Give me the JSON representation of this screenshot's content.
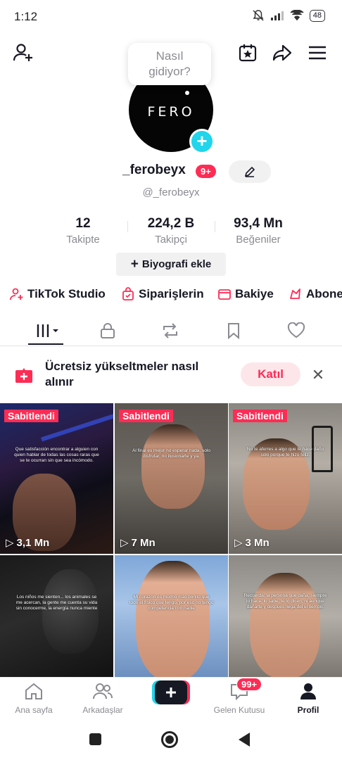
{
  "status": {
    "time": "1:12",
    "battery": "48"
  },
  "bubble": {
    "line1": "Nasıl",
    "line2": "gidiyor?"
  },
  "avatar": {
    "text": "FERO"
  },
  "profile": {
    "username": "_ferobeyx",
    "badge": "9+",
    "handle": "@_ferobeyx"
  },
  "stats": [
    {
      "value": "12",
      "label": "Takipte"
    },
    {
      "value": "224,2 B",
      "label": "Takipçi"
    },
    {
      "value": "93,4 Mn",
      "label": "Beğeniler"
    }
  ],
  "bio_button": "Biyografi ekle",
  "shortcuts": [
    {
      "label": "TikTok Studio",
      "icon": "person-plus-icon"
    },
    {
      "label": "Siparişlerin",
      "icon": "shopping-bag-icon"
    },
    {
      "label": "Bakiye",
      "icon": "wallet-icon"
    },
    {
      "label": "Abone",
      "icon": "subscription-icon"
    }
  ],
  "tabs": [
    {
      "name": "videos",
      "icon": "grid-bars-icon"
    },
    {
      "name": "private",
      "icon": "lock-icon"
    },
    {
      "name": "reposts",
      "icon": "repost-icon"
    },
    {
      "name": "favorites",
      "icon": "bookmark-icon"
    },
    {
      "name": "liked",
      "icon": "heart-icon"
    }
  ],
  "promo": {
    "text": "Ücretsiz yükseltmeler nasıl alınır",
    "join": "Katıl"
  },
  "videos": [
    {
      "pinned": "Sabitlendi",
      "views": "3,1 Mn",
      "caption": "Que satisfacción encontrar a alguien con quien hablar de todas las cosas raras que se te ocurran sin que sea incómodo."
    },
    {
      "pinned": "Sabitlendi",
      "views": "7 Mn",
      "caption": "Al final es mejor no esperar nada, solo disfrutar, no ilusionarte y ya."
    },
    {
      "pinned": "Sabitlendi",
      "views": "3 Mn",
      "caption": "No te aferres a algo que te hace daño solo porque te hizo feliz."
    },
    {
      "pinned": "",
      "views": "",
      "caption": "Los niños me sienten... los animales se me acercan, la gente me cuenta su vida sin conocerme, la energía nunca miente"
    },
    {
      "pinned": "",
      "views": "",
      "caption": "Mi corazón es mucho más bonito que todo el físico que tengo, por eso no tengo competencia con nadie"
    },
    {
      "pinned": "",
      "views": "",
      "caption": "Recuerda: la persona que daña, siempre lo hace. lo sabe, te lo dicen, ni aunque dañarte y después llega del el tiempo."
    }
  ],
  "nav": [
    {
      "label": "Ana sayfa",
      "icon": "home-icon"
    },
    {
      "label": "Arkadaşlar",
      "icon": "friends-icon"
    },
    {
      "label": "",
      "icon": "create-plus-icon"
    },
    {
      "label": "Gelen Kutusu",
      "icon": "inbox-icon",
      "badge": "99+"
    },
    {
      "label": "Profil",
      "icon": "profile-icon"
    }
  ],
  "colors": {
    "accent": "#fe2c55",
    "cyan": "#20d5ec",
    "muted": "#8a8b91"
  }
}
